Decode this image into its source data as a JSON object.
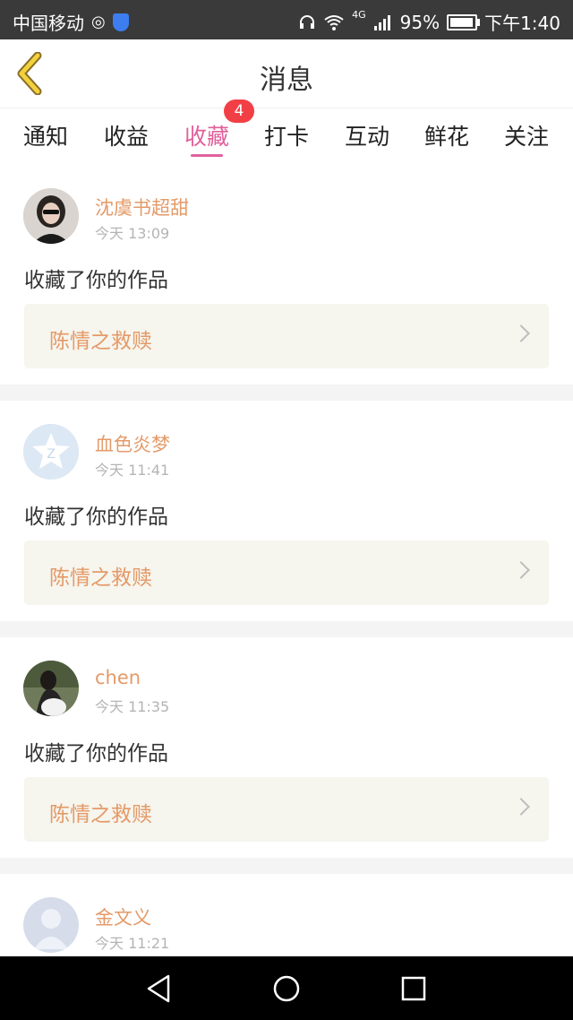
{
  "status_bar": {
    "carrier": "中国移动",
    "network": "4G",
    "battery": "95%",
    "battery_level": 0.95,
    "time": "下午1:40"
  },
  "header": {
    "title": "消息"
  },
  "tabs": {
    "items": [
      {
        "label": "通知"
      },
      {
        "label": "收益"
      },
      {
        "label": "收藏",
        "active": true,
        "badge": "4"
      },
      {
        "label": "打卡"
      },
      {
        "label": "互动"
      },
      {
        "label": "鲜花"
      },
      {
        "label": "关注"
      }
    ]
  },
  "messages": [
    {
      "username": "沈虞书超甜",
      "time": "今天 13:09",
      "action": "收藏了你的作品",
      "work": "陈情之救赎"
    },
    {
      "username": "血色炎梦",
      "time": "今天 11:41",
      "action": "收藏了你的作品",
      "work": "陈情之救赎"
    },
    {
      "username": "chen",
      "time": "今天 11:35",
      "action": "收藏了你的作品",
      "work": "陈情之救赎"
    },
    {
      "username": "金文义",
      "time": "今天 11:21"
    }
  ],
  "colors": {
    "accent_pink": "#e0609c",
    "username_orange": "#e49a68",
    "badge_red": "#f23f46",
    "work_box_bg": "#f6f5ee"
  }
}
